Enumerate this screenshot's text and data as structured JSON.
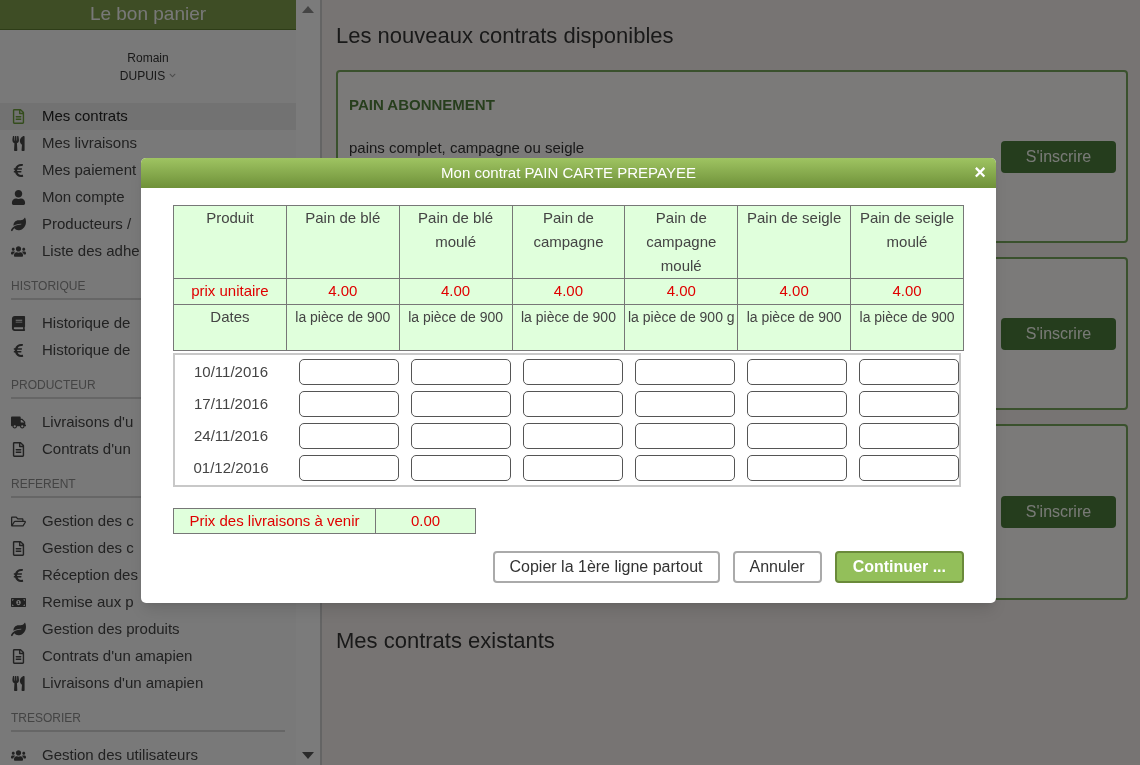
{
  "sidebar": {
    "title": "Le bon panier",
    "user": {
      "first_name": "Romain",
      "last_name": "DUPUIS"
    },
    "items": [
      {
        "kind": "item",
        "label": "Mes contrats",
        "selected": true
      },
      {
        "kind": "item",
        "label": "Mes livraisons",
        "selected": false
      },
      {
        "kind": "item",
        "label": "Mes paiement",
        "selected": false
      },
      {
        "kind": "item",
        "label": "Mon compte",
        "selected": false
      },
      {
        "kind": "item",
        "label": "Producteurs /",
        "selected": false
      },
      {
        "kind": "item",
        "label": "Liste des adhe",
        "selected": false
      },
      {
        "kind": "section",
        "label": "HISTORIQUE"
      },
      {
        "kind": "item",
        "label": "Historique de",
        "selected": false
      },
      {
        "kind": "item",
        "label": "Historique de",
        "selected": false
      },
      {
        "kind": "section",
        "label": "PRODUCTEUR"
      },
      {
        "kind": "item",
        "label": "Livraisons d'u",
        "selected": false
      },
      {
        "kind": "item",
        "label": "Contrats d'un",
        "selected": false
      },
      {
        "kind": "section",
        "label": "REFERENT"
      },
      {
        "kind": "item",
        "label": "Gestion des c",
        "selected": false
      },
      {
        "kind": "item",
        "label": "Gestion des c",
        "selected": false
      },
      {
        "kind": "item",
        "label": "Réception des",
        "selected": false
      },
      {
        "kind": "item",
        "label": "Remise aux p",
        "selected": false
      },
      {
        "kind": "item",
        "label": "Gestion des produits",
        "selected": false
      },
      {
        "kind": "item",
        "label": "Contrats d'un amapien",
        "selected": false
      },
      {
        "kind": "item",
        "label": "Livraisons d'un amapien",
        "selected": false
      },
      {
        "kind": "section",
        "label": "TRESORIER"
      },
      {
        "kind": "item",
        "label": "Gestion des utilisateurs",
        "selected": false
      }
    ]
  },
  "page": {
    "title": "Les nouveaux contrats disponibles",
    "contracts": [
      {
        "title": "PAIN ABONNEMENT",
        "description": "pains complet, campagne ou seigle",
        "button": "S'inscrire"
      },
      {
        "button": "S'inscrire"
      },
      {
        "button": "S'inscrire"
      }
    ],
    "existing_title": "Mes contrats existants"
  },
  "modal": {
    "title": "Mon contrat PAIN CARTE PREPAYEE",
    "close": "×",
    "product_label": "Produit",
    "products": [
      "Pain de blé",
      "Pain de blé moulé",
      "Pain de campagne",
      "Pain de campagne moulé",
      "Pain de seigle",
      "Pain de seigle moulé"
    ],
    "price_label": "prix unitaire",
    "prices": [
      "4.00",
      "4.00",
      "4.00",
      "4.00",
      "4.00",
      "4.00"
    ],
    "dates_label": "Dates",
    "units": [
      "la pièce de 900",
      "la pièce de 900",
      "la pièce de 900",
      "la pièce de 900 g",
      "la pièce de 900",
      "la pièce de 900"
    ],
    "deliveries": [
      {
        "date": "10/11/2016"
      },
      {
        "date": "17/11/2016"
      },
      {
        "date": "24/11/2016"
      },
      {
        "date": "01/12/2016"
      }
    ],
    "total_label": "Prix des livraisons à venir",
    "total": "0.00",
    "buttons": [
      {
        "kind": "secondary",
        "label": "Copier la 1ère ligne partout"
      },
      {
        "kind": "secondary",
        "label": "Annuler"
      },
      {
        "kind": "primary",
        "label": "Continuer ..."
      }
    ]
  }
}
